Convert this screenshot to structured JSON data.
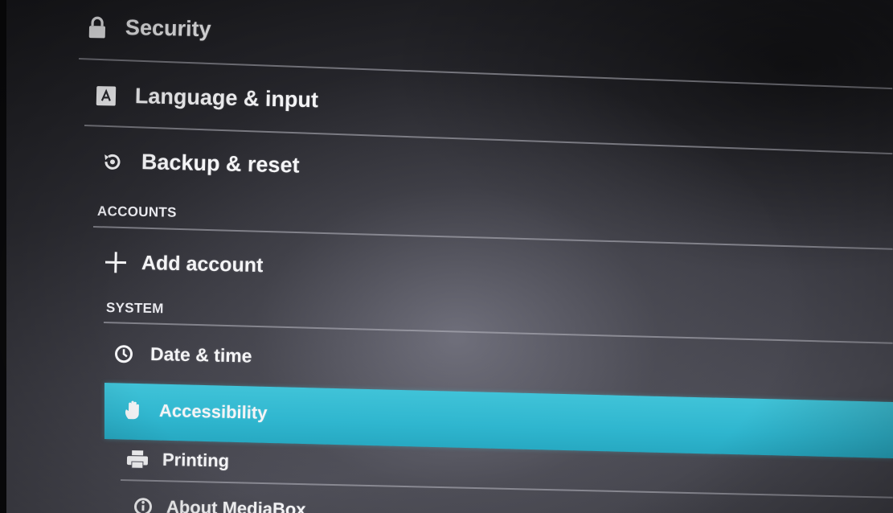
{
  "settings_list": {
    "rows": [
      {
        "label": "Security",
        "icon": "lock-icon"
      },
      {
        "label": "Language & input",
        "icon": "keyboard-icon"
      },
      {
        "label": "Backup & reset",
        "icon": "restore-icon"
      },
      {
        "label": "Add account",
        "icon": "plus-icon"
      },
      {
        "label": "Date & time",
        "icon": "clock-icon"
      },
      {
        "label": "Accessibility",
        "icon": "hand-icon",
        "selected": true
      },
      {
        "label": "Printing",
        "icon": "printer-icon"
      },
      {
        "label": "About MediaBox",
        "icon": "info-icon"
      }
    ],
    "sections": {
      "accounts": "ACCOUNTS",
      "system": "SYSTEM"
    },
    "highlight_color": "#33b9d2"
  }
}
